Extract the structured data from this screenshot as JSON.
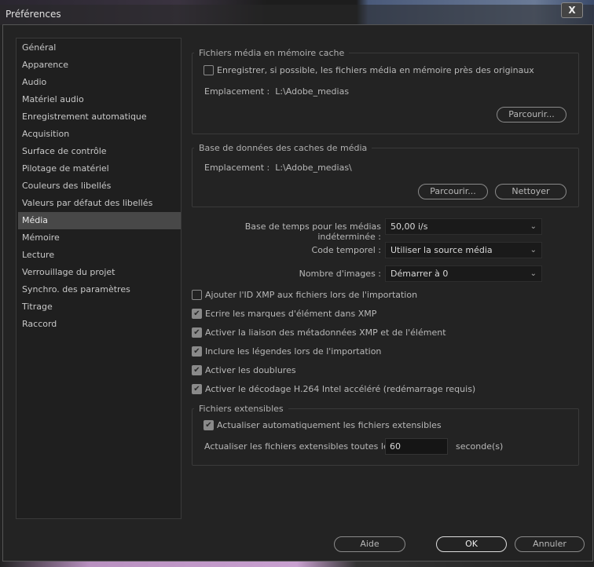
{
  "window": {
    "title": "Préférences",
    "close_label": "X"
  },
  "sidebar": {
    "items": [
      {
        "label": "Général"
      },
      {
        "label": "Apparence"
      },
      {
        "label": "Audio"
      },
      {
        "label": "Matériel audio"
      },
      {
        "label": "Enregistrement automatique"
      },
      {
        "label": "Acquisition"
      },
      {
        "label": "Surface de contrôle"
      },
      {
        "label": "Pilotage de matériel"
      },
      {
        "label": "Couleurs des libellés"
      },
      {
        "label": "Valeurs par défaut des libellés"
      },
      {
        "label": "Média",
        "selected": true
      },
      {
        "label": "Mémoire"
      },
      {
        "label": "Lecture"
      },
      {
        "label": "Verrouillage du projet"
      },
      {
        "label": "Synchro. des paramètres"
      },
      {
        "label": "Titrage"
      },
      {
        "label": "Raccord"
      }
    ]
  },
  "cache": {
    "title": "Fichiers média en mémoire cache",
    "checkbox": "Enregistrer, si possible, les fichiers média en mémoire près des originaux",
    "checked": false,
    "location_label": "Emplacement :",
    "location": "L:\\Adobe_medias",
    "browse": "Parcourir..."
  },
  "db": {
    "title": "Base de données des caches de média",
    "location_label": "Emplacement :",
    "location": "L:\\Adobe_medias\\",
    "browse": "Parcourir...",
    "clean": "Nettoyer"
  },
  "settings": {
    "timebase_label": "Base de temps pour les médias indéterminée :",
    "timebase": "50,00  i/s",
    "timecode_label": "Code temporel :",
    "timecode": "Utiliser la source média",
    "frames_label": "Nombre d'images :",
    "frames": "Démarrer à 0"
  },
  "checks": [
    {
      "label": "Ajouter l'ID XMP aux fichiers lors de l'importation",
      "checked": false
    },
    {
      "label": "Ecrire les marques d'élément dans XMP",
      "checked": true
    },
    {
      "label": "Activer la liaison des métadonnées XMP et de l'élément",
      "checked": true
    },
    {
      "label": "Inclure les légendes lors de l'importation",
      "checked": true
    },
    {
      "label": "Activer les doublures",
      "checked": true
    },
    {
      "label": "Activer le décodage H.264 Intel accéléré (redémarrage requis)",
      "checked": true
    }
  ],
  "growing": {
    "title": "Fichiers extensibles",
    "auto_label": "Actualiser automatiquement les fichiers extensibles",
    "auto_checked": true,
    "interval_label": "Actualiser les fichiers extensibles toutes les",
    "interval": "60",
    "unit": "seconde(s)"
  },
  "footer": {
    "help": "Aide",
    "ok": "OK",
    "cancel": "Annuler"
  },
  "icons": {
    "check": "✔",
    "chevron": "⌄"
  }
}
